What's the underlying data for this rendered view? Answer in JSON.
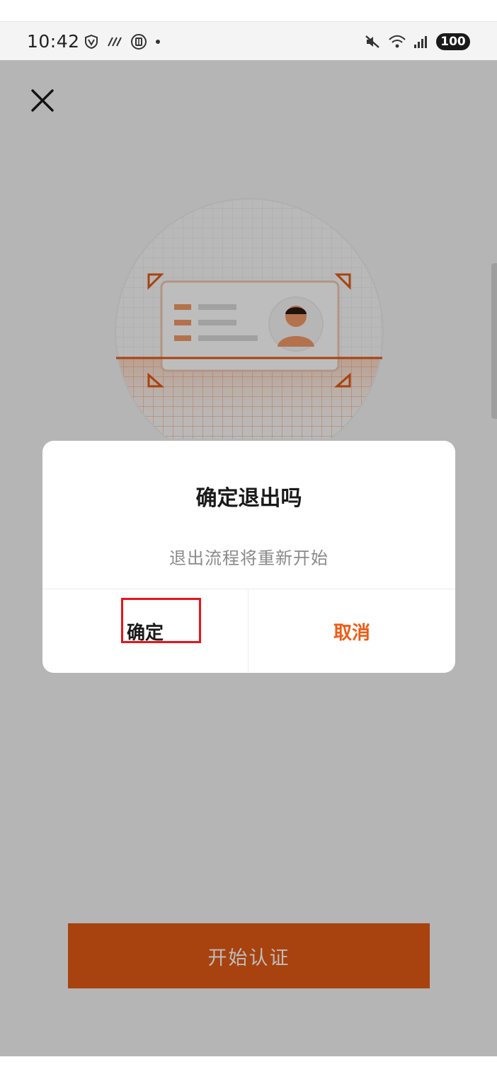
{
  "status_bar": {
    "time": "10:42",
    "left_icons": [
      "vpn-shield-icon",
      "nfc-icon",
      "pause-circle-icon",
      "dot-icon"
    ],
    "right_icons": [
      "mute-icon",
      "wifi-icon",
      "signal-icon"
    ],
    "battery": "100"
  },
  "header": {
    "close_icon": "close-icon"
  },
  "dialog": {
    "title": "确定退出吗",
    "message": "退出流程将重新开始",
    "confirm_label": "确定",
    "cancel_label": "取消"
  },
  "footer": {
    "start_label": "开始认证"
  },
  "colors": {
    "accent": "#e35a13",
    "cancel_text": "#f05a14",
    "highlight": "#e8141c"
  }
}
